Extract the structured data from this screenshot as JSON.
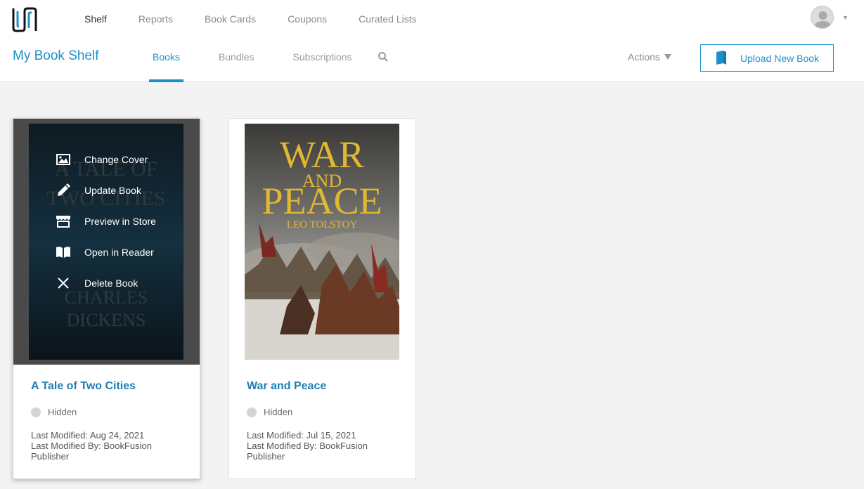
{
  "topnav": {
    "items": [
      {
        "label": "Shelf",
        "active": true
      },
      {
        "label": "Reports",
        "active": false
      },
      {
        "label": "Book Cards",
        "active": false
      },
      {
        "label": "Coupons",
        "active": false
      },
      {
        "label": "Curated Lists",
        "active": false
      }
    ]
  },
  "header": {
    "title": "My Book Shelf",
    "tabs": [
      {
        "label": "Books",
        "active": true
      },
      {
        "label": "Bundles",
        "active": false
      },
      {
        "label": "Subscriptions",
        "active": false
      }
    ],
    "actions_label": "Actions",
    "upload_label": "Upload New Book"
  },
  "hover_menu": {
    "items": [
      {
        "label": "Change Cover",
        "icon": "image-icon"
      },
      {
        "label": "Update Book",
        "icon": "pencil-icon"
      },
      {
        "label": "Preview in Store",
        "icon": "store-icon"
      },
      {
        "label": "Open in Reader",
        "icon": "book-open-icon"
      },
      {
        "label": "Delete Book",
        "icon": "close-icon"
      }
    ]
  },
  "books": [
    {
      "title": "A Tale of Two Cities",
      "status": "Hidden",
      "last_modified": "Last Modified: Aug 24, 2021",
      "last_modified_by": "Last Modified By: BookFusion Publisher",
      "cover": {
        "line1": "A TALE OF",
        "line2": "TWO CITIES",
        "author1": "CHARLES",
        "author2": "DICKENS"
      }
    },
    {
      "title": "War and Peace",
      "status": "Hidden",
      "last_modified": "Last Modified: Jul 15, 2021",
      "last_modified_by": "Last Modified By: BookFusion Publisher",
      "cover": {
        "word1": "WAR",
        "word2": "AND",
        "word3": "PEACE",
        "author": "LEO TOLSTOY"
      }
    }
  ],
  "colors": {
    "accent": "#1e90c8",
    "status_dot": "#d4d4d4"
  }
}
